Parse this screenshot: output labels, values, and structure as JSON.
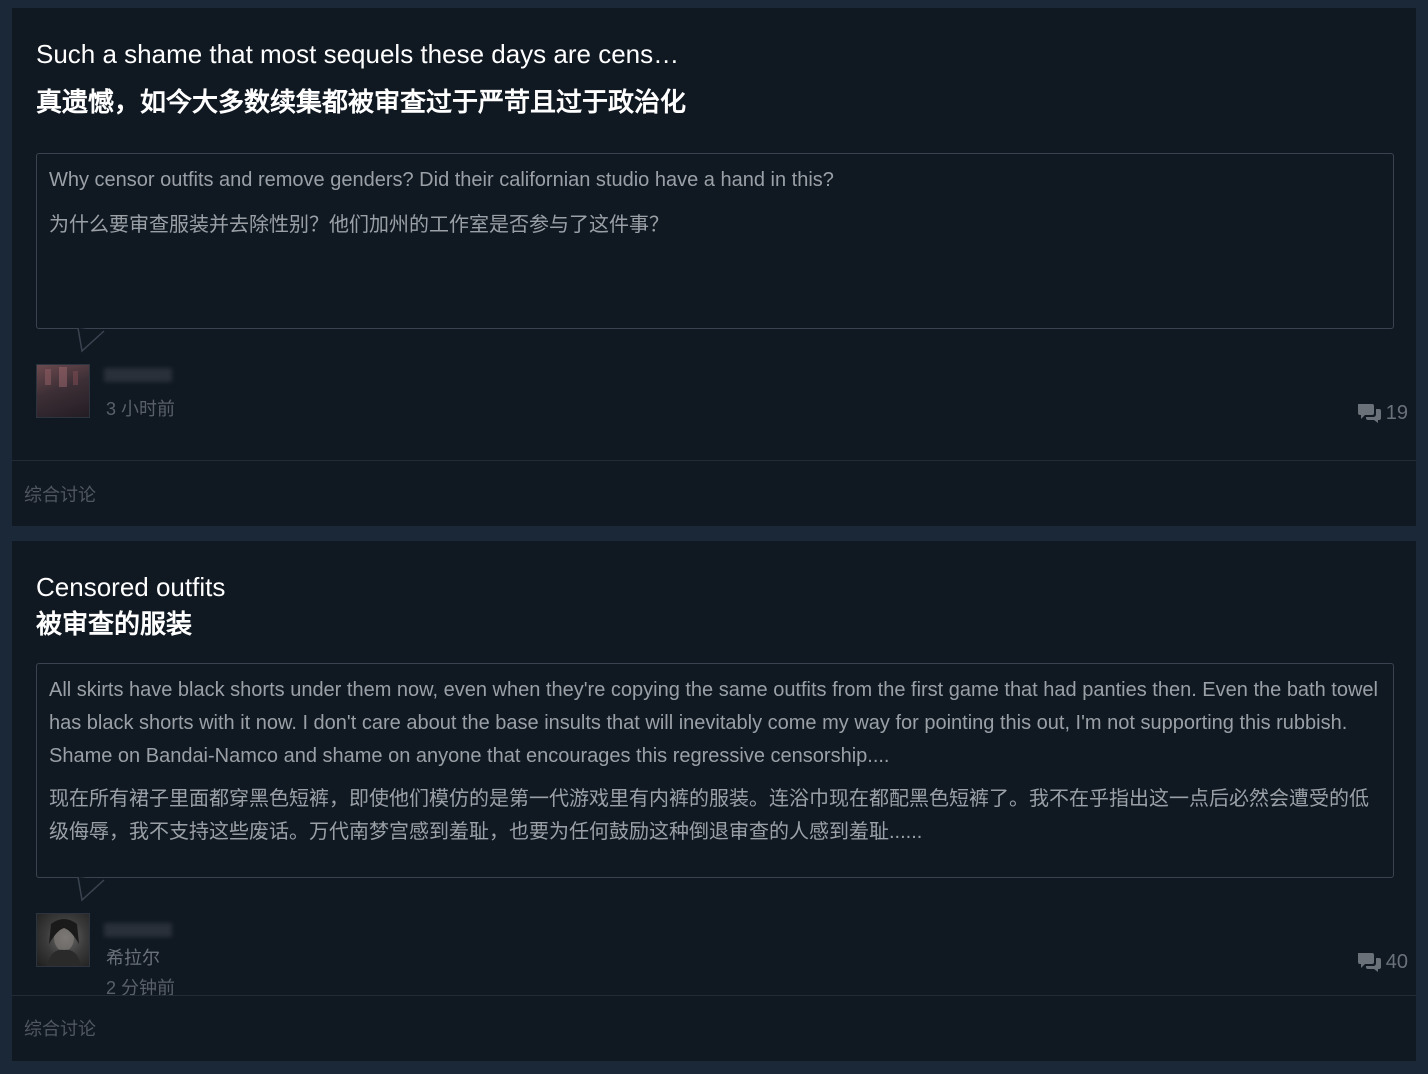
{
  "threads": [
    {
      "title_en": "Such a shame that most sequels these days are cens…",
      "title_zh": "真遗憾，如今大多数续集都被审查过于严苛且过于政治化",
      "body_en": "Why censor outfits and remove genders? Did their californian studio have a hand in this?",
      "body_zh": "为什么要审查服装并去除性别？他们加州的工作室是否参与了这件事？",
      "time": "3 小时前",
      "replies": "19",
      "forum": "综合讨论",
      "avatar_icon": "user-avatar"
    },
    {
      "title_en": "Censored outfits",
      "title_zh": "被审查的服装",
      "body_en": "All skirts have black shorts under them now, even when they're copying the same outfits from the first game that had panties then. Even the bath towel has black shorts with it now. I don't care about the base insults that will inevitably come my way for pointing this out, I'm not supporting this rubbish. Shame on Bandai-Namco and shame on anyone that encourages this regressive censorship....",
      "body_zh": "现在所有裙子里面都穿黑色短裤，即使他们模仿的是第一代游戏里有内裤的服装。连浴巾现在都配黑色短裤了。我不在乎指出这一点后必然会遭受的低级侮辱，我不支持这些废话。万代南梦宫感到羞耻，也要为任何鼓励这种倒退审查的人感到羞耻......",
      "author_zh": "希拉尔",
      "time": "2 分钟前",
      "replies": "40",
      "forum": "综合讨论",
      "avatar_icon": "user-avatar"
    }
  ],
  "colors": {
    "background": "#1b2838",
    "card": "#101822",
    "title": "#ffffff",
    "body": "#9aa0a6",
    "muted": "#5a6069"
  },
  "icons": {
    "replies": "speech-bubbles-icon"
  }
}
